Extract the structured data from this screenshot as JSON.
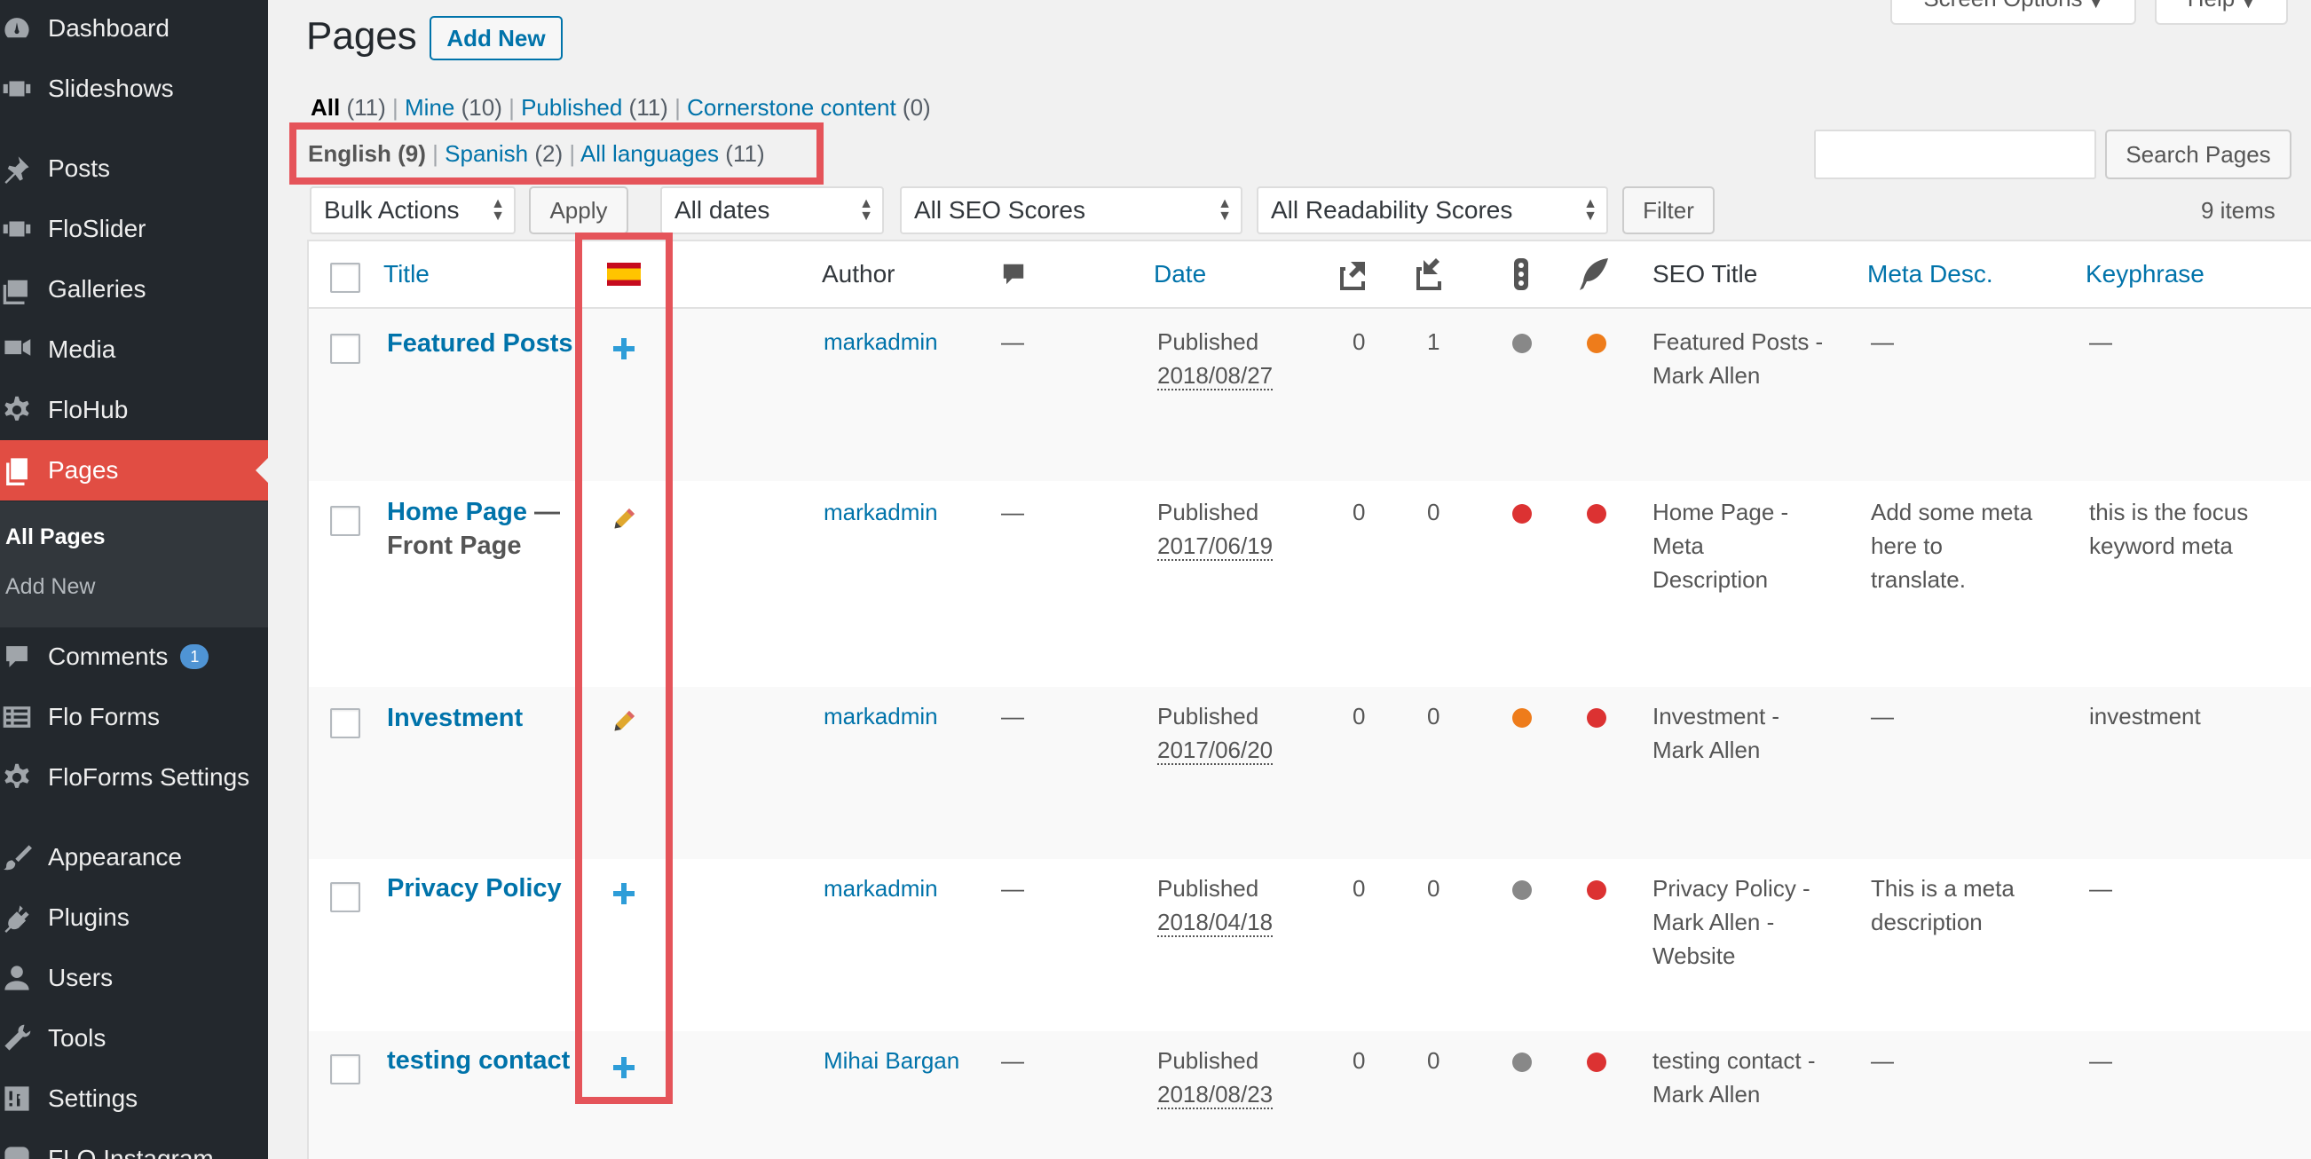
{
  "colors": {
    "sidebar_bg": "#23282d",
    "active_menu": "#e14d43",
    "link": "#0073aa",
    "highlight_box": "#e5545a",
    "dot_gray": "#888888",
    "dot_orange": "#ee7c1b",
    "dot_red": "#dc3232"
  },
  "sidebar": {
    "items": [
      {
        "label": "Dashboard",
        "icon": "dashboard-icon"
      },
      {
        "label": "Slideshows",
        "icon": "slideshow-icon"
      },
      {
        "label": "Posts",
        "icon": "pushpin-icon"
      },
      {
        "label": "FloSlider",
        "icon": "slider-icon"
      },
      {
        "label": "Galleries",
        "icon": "gallery-icon"
      },
      {
        "label": "Media",
        "icon": "media-icon"
      },
      {
        "label": "FloHub",
        "icon": "gear-icon"
      },
      {
        "label": "Pages",
        "icon": "pages-icon"
      },
      {
        "label": "Comments",
        "icon": "comment-icon",
        "badge": "1"
      },
      {
        "label": "Flo Forms",
        "icon": "forms-icon"
      },
      {
        "label": "FloForms Settings",
        "icon": "gear-icon"
      },
      {
        "label": "Appearance",
        "icon": "brush-icon"
      },
      {
        "label": "Plugins",
        "icon": "plugin-icon"
      },
      {
        "label": "Users",
        "icon": "user-icon"
      },
      {
        "label": "Tools",
        "icon": "wrench-icon"
      },
      {
        "label": "Settings",
        "icon": "settings-icon"
      },
      {
        "label": "FLO Instagram",
        "icon": "instagram-icon"
      }
    ],
    "submenu": {
      "all_pages": "All Pages",
      "add_new": "Add New"
    }
  },
  "header": {
    "title": "Pages",
    "add_new": "Add New",
    "screen_options": "Screen Options",
    "help": "Help"
  },
  "filters": {
    "status": [
      {
        "label": "All",
        "count": "(11)"
      },
      {
        "label": "Mine",
        "count": "(10)"
      },
      {
        "label": "Published",
        "count": "(11)"
      },
      {
        "label": "Cornerstone content",
        "count": "(0)"
      }
    ],
    "languages": [
      {
        "label": "English",
        "count": "(9)"
      },
      {
        "label": "Spanish",
        "count": "(2)"
      },
      {
        "label": "All languages",
        "count": "(11)"
      }
    ],
    "sep": "|"
  },
  "toolbar": {
    "bulk_actions": "Bulk Actions",
    "apply": "Apply",
    "dates": "All dates",
    "seo_scores": "All SEO Scores",
    "readability": "All Readability Scores",
    "filter": "Filter",
    "search_button": "Search Pages",
    "search_value": "",
    "items_count": "9 items"
  },
  "table": {
    "headers": {
      "title": "Title",
      "author": "Author",
      "date": "Date",
      "seo_title": "SEO Title",
      "meta_desc": "Meta Desc.",
      "keyphrase": "Keyphrase"
    },
    "rows": [
      {
        "title": "Featured Posts",
        "suffix": "",
        "lang_action": "add",
        "author": "markadmin",
        "comments": "—",
        "status": "Published",
        "date": "2018/08/27",
        "links_out": "0",
        "links_in": "1",
        "seo": "gray",
        "readability": "orange",
        "seo_title": [
          "Featured Posts -",
          "Mark Allen"
        ],
        "meta_desc": [
          "—"
        ],
        "keyphrase": [
          "—"
        ]
      },
      {
        "title": "Home Page",
        "suffix": " —",
        "suffix2": "Front Page",
        "lang_action": "edit",
        "author": "markadmin",
        "comments": "—",
        "status": "Published",
        "date": "2017/06/19",
        "links_out": "0",
        "links_in": "0",
        "seo": "red",
        "readability": "red",
        "seo_title": [
          "Home Page -",
          "Meta",
          "Description"
        ],
        "meta_desc": [
          "Add some meta",
          "here to",
          "translate."
        ],
        "keyphrase": [
          "this is the focus",
          "keyword meta"
        ]
      },
      {
        "title": "Investment",
        "suffix": "",
        "lang_action": "edit",
        "author": "markadmin",
        "comments": "—",
        "status": "Published",
        "date": "2017/06/20",
        "links_out": "0",
        "links_in": "0",
        "seo": "orange",
        "readability": "red",
        "seo_title": [
          "Investment -",
          "Mark Allen"
        ],
        "meta_desc": [
          "—"
        ],
        "keyphrase": [
          "investment"
        ]
      },
      {
        "title": "Privacy Policy",
        "suffix": "",
        "lang_action": "add",
        "author": "markadmin",
        "comments": "—",
        "status": "Published",
        "date": "2018/04/18",
        "links_out": "0",
        "links_in": "0",
        "seo": "gray",
        "readability": "red",
        "seo_title": [
          "Privacy Policy -",
          "Mark Allen -",
          "Website"
        ],
        "meta_desc": [
          "This is a meta",
          "description"
        ],
        "keyphrase": [
          "—"
        ]
      },
      {
        "title": "testing contact",
        "suffix": "",
        "lang_action": "add",
        "author": "Mihai Bargan",
        "comments": "—",
        "status": "Published",
        "date": "2018/08/23",
        "links_out": "0",
        "links_in": "0",
        "seo": "gray",
        "readability": "red",
        "seo_title": [
          "testing contact -",
          "Mark Allen"
        ],
        "meta_desc": [
          "—"
        ],
        "keyphrase": [
          "—"
        ]
      }
    ]
  }
}
